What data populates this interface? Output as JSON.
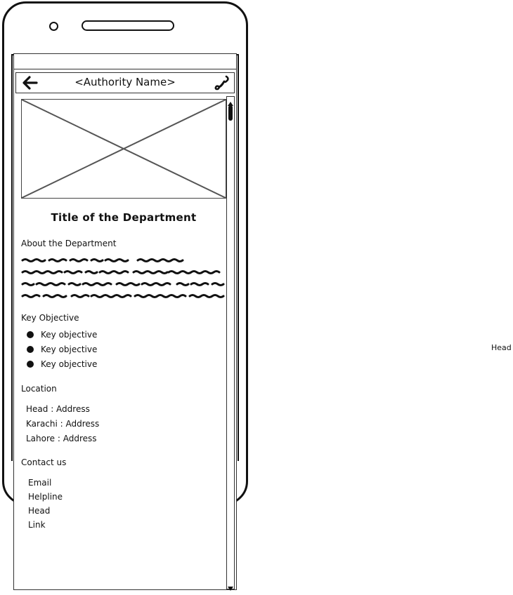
{
  "appbar": {
    "title": "<Authority Name>",
    "back_icon": "arrow-left-icon",
    "call_icon": "phone-icon"
  },
  "department": {
    "title": "Title of the Department",
    "about_label": "About the Department"
  },
  "key_objective": {
    "label": "Key Objective",
    "items": [
      "Key objective",
      "Key objective",
      "Key objective"
    ]
  },
  "location": {
    "label": "Location",
    "items": [
      "Head : Address",
      "Karachi : Address",
      "Lahore : Address"
    ]
  },
  "contact": {
    "label": "Contact us",
    "items": [
      "Email",
      "Helpline",
      "Head",
      "Link"
    ]
  },
  "stray_label": "Head",
  "colors": {
    "ink": "#111111",
    "line": "#444444",
    "background": "#ffffff"
  }
}
